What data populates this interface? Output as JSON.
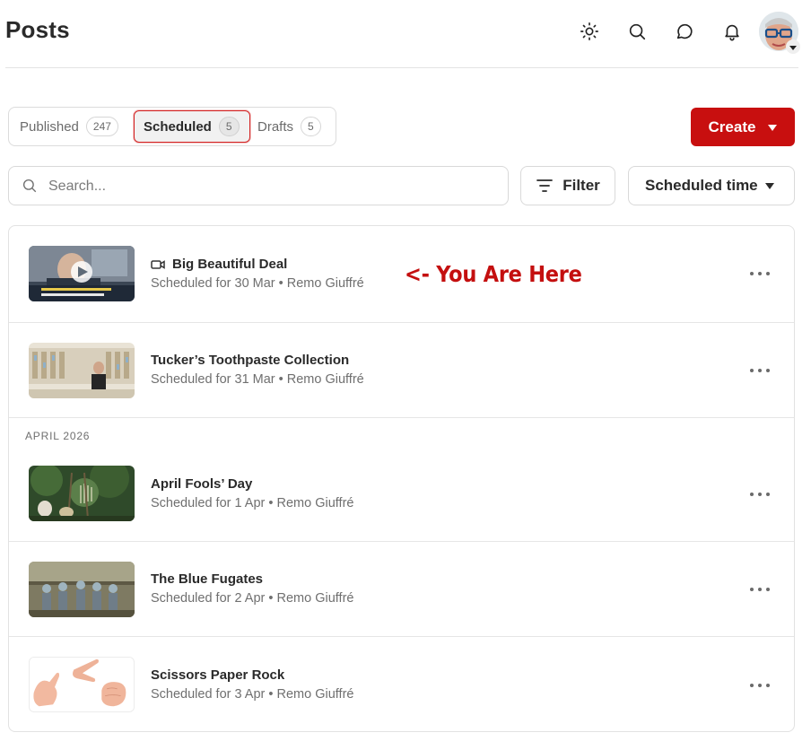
{
  "header": {
    "title": "Posts",
    "icons": [
      "sun-icon",
      "search-icon",
      "chat-bubble-icon",
      "bell-icon"
    ]
  },
  "tabs": [
    {
      "label": "Published",
      "count": "247",
      "active": false
    },
    {
      "label": "Scheduled",
      "count": "5",
      "active": true
    },
    {
      "label": "Drafts",
      "count": "5",
      "active": false
    }
  ],
  "create_button": {
    "label": "Create"
  },
  "search": {
    "placeholder": "Search..."
  },
  "filter_button": {
    "label": "Filter"
  },
  "sort_button": {
    "label": "Scheduled time"
  },
  "annotation": {
    "text": "<- You Are Here"
  },
  "section": {
    "label": "APRIL 2026"
  },
  "posts": [
    {
      "title": "Big Beautiful Deal",
      "meta": "Scheduled for 30 Mar • Remo Giuffré",
      "has_video": true,
      "thumb_icon": "video-thumbnail"
    },
    {
      "title": "Tucker’s Toothpaste Collection",
      "meta": "Scheduled for 31 Mar • Remo Giuffré",
      "has_video": false,
      "thumb_icon": "store-shelves-thumbnail"
    },
    {
      "title": "April Fools’ Day",
      "meta": "Scheduled for 1 Apr • Remo Giuffré",
      "has_video": false,
      "thumb_icon": "spaghetti-tree-thumbnail"
    },
    {
      "title": "The Blue Fugates",
      "meta": "Scheduled for 2 Apr • Remo Giuffré",
      "has_video": false,
      "thumb_icon": "family-photo-thumbnail"
    },
    {
      "title": "Scissors Paper Rock",
      "meta": "Scheduled for 3 Apr • Remo Giuffré",
      "has_video": false,
      "thumb_icon": "hand-gestures-thumbnail"
    }
  ],
  "colors": {
    "accent": "#c80f0f",
    "annotation": "#c40f0f",
    "text_muted": "#6f6f6f"
  }
}
